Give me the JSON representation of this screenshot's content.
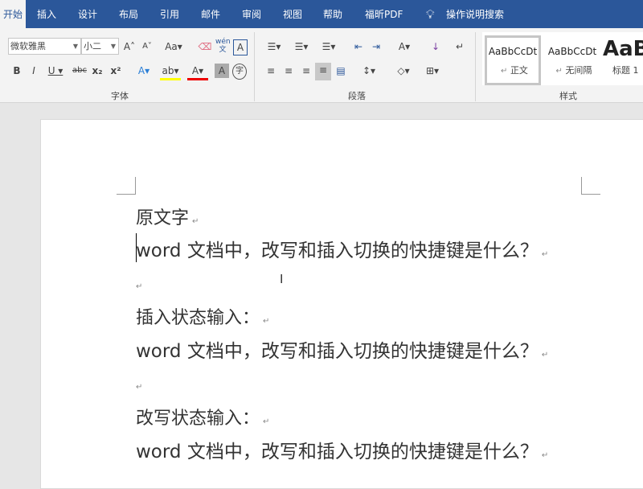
{
  "tabs": [
    "开始",
    "插入",
    "设计",
    "布局",
    "引用",
    "邮件",
    "审阅",
    "视图",
    "帮助",
    "福昕PDF",
    "操作说明搜索"
  ],
  "font": {
    "name": "微软雅黑",
    "size": "小二",
    "group": "字体"
  },
  "paragraph": {
    "group": "段落"
  },
  "styles": {
    "group": "样式",
    "items": [
      {
        "preview": "AaBbCcDt",
        "label": "正文"
      },
      {
        "preview": "AaBbCcDt",
        "label": "无间隔"
      },
      {
        "preview": "AaB",
        "label": "标题 1"
      }
    ]
  },
  "doc": {
    "return_mark": "↵",
    "lines": [
      "原文字",
      "word  文档中，改写和插入切换的快捷键是什么？",
      "",
      "插入状态输入：",
      "word  文档中，改写和插入切换的快捷键是什么？",
      "",
      "改写状态输入：",
      "word  文档中，改写和插入切换的快捷键是什么？"
    ]
  },
  "colors": {
    "accent": "#2b579a"
  }
}
